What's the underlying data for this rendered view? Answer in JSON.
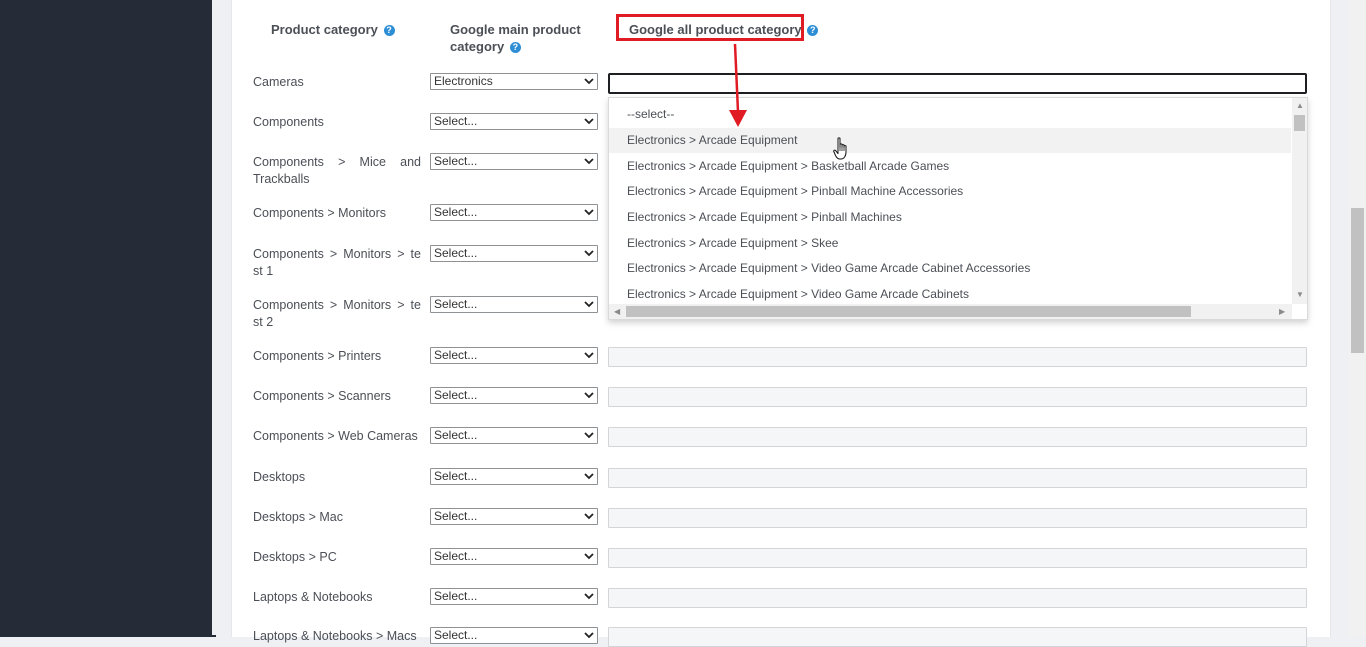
{
  "headers": {
    "product_category": "Product category",
    "google_main_line1": "Google main product",
    "google_main_line2": "category",
    "google_all": "Google all product category",
    "help_glyph": "?"
  },
  "rows": [
    {
      "category": "Cameras",
      "main_select": "Electronics"
    },
    {
      "category": "Components",
      "main_select": "Select..."
    },
    {
      "category": "Components > Mice and Trackballs",
      "main_select": "Select..."
    },
    {
      "category": "Components > Monitors",
      "main_select": "Select..."
    },
    {
      "category": "Components > Monitors > test 1",
      "main_select": "Select..."
    },
    {
      "category": "Components > Monitors > test 2",
      "main_select": "Select..."
    },
    {
      "category": "Components > Printers",
      "main_select": "Select..."
    },
    {
      "category": "Components > Scanners",
      "main_select": "Select..."
    },
    {
      "category": "Components > Web Cameras",
      "main_select": "Select..."
    },
    {
      "category": "Desktops",
      "main_select": "Select..."
    },
    {
      "category": "Desktops > Mac",
      "main_select": "Select..."
    },
    {
      "category": "Desktops > PC",
      "main_select": "Select..."
    },
    {
      "category": "Laptops & Notebooks",
      "main_select": "Select..."
    },
    {
      "category": "Laptops & Notebooks > Macs",
      "main_select": "Select..."
    }
  ],
  "dropdown": {
    "options": [
      "--select--",
      "Electronics > Arcade Equipment",
      "Electronics > Arcade Equipment > Basketball Arcade Games",
      "Electronics > Arcade Equipment > Pinball Machine Accessories",
      "Electronics > Arcade Equipment > Pinball Machines",
      "Electronics > Arcade Equipment > Skee",
      "Electronics > Arcade Equipment > Video Game Arcade Cabinet Accessories",
      "Electronics > Arcade Equipment > Video Game Arcade Cabinets"
    ],
    "hovered": "Electronics > Arcade Equipment"
  },
  "colors": {
    "sidebar": "#252b37",
    "highlight": "#e01b24",
    "help_icon": "#2d8ed5"
  }
}
